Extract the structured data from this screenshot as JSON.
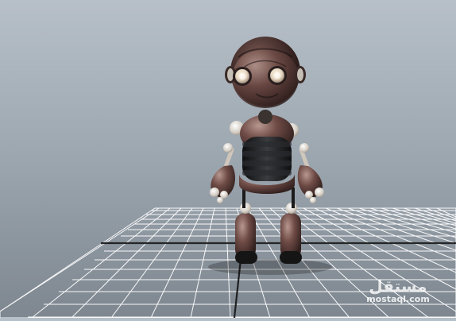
{
  "viewport": {
    "background_top": "#b7c0c8",
    "background_bottom": "#7e8790",
    "grid_color": "#ffffff",
    "grid_axis_color": "#202020",
    "robot_body_color": "#6b4a45",
    "robot_joint_color": "#d8d2c8"
  },
  "watermark": {
    "main": "مستقل",
    "sub": "mostaql.com"
  }
}
